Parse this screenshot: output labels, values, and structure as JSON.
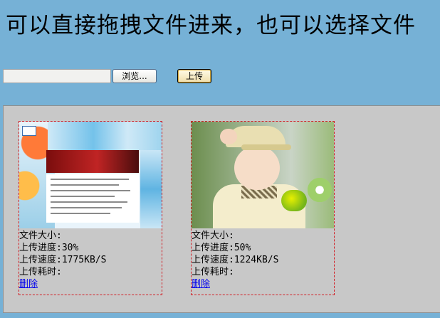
{
  "header": {
    "title": "可以直接拖拽文件进来，也可以选择文件"
  },
  "file_selector": {
    "browse_label": "浏览...",
    "upload_label": "上传",
    "file_value": ""
  },
  "uploads": [
    {
      "thumbnail": "website-screenshot-thumbnail",
      "size_label": "文件大小:",
      "progress_label": "上传进度:30%",
      "speed_label": "上传速度:1775KB/S",
      "elapsed_label": "上传耗时:",
      "delete_label": "删除",
      "progress": 0.3
    },
    {
      "thumbnail": "child-photo-thumbnail",
      "size_label": "文件大小:",
      "progress_label": "上传进度:50%",
      "speed_label": "上传速度:1224KB/S",
      "elapsed_label": "上传耗时:",
      "delete_label": "删除",
      "progress": 0.5
    }
  ],
  "colors": {
    "page_background": "#76b1d6",
    "drop_zone_background": "#c8c8c8",
    "card_border": "#d21d24",
    "link": "#0000ee"
  }
}
